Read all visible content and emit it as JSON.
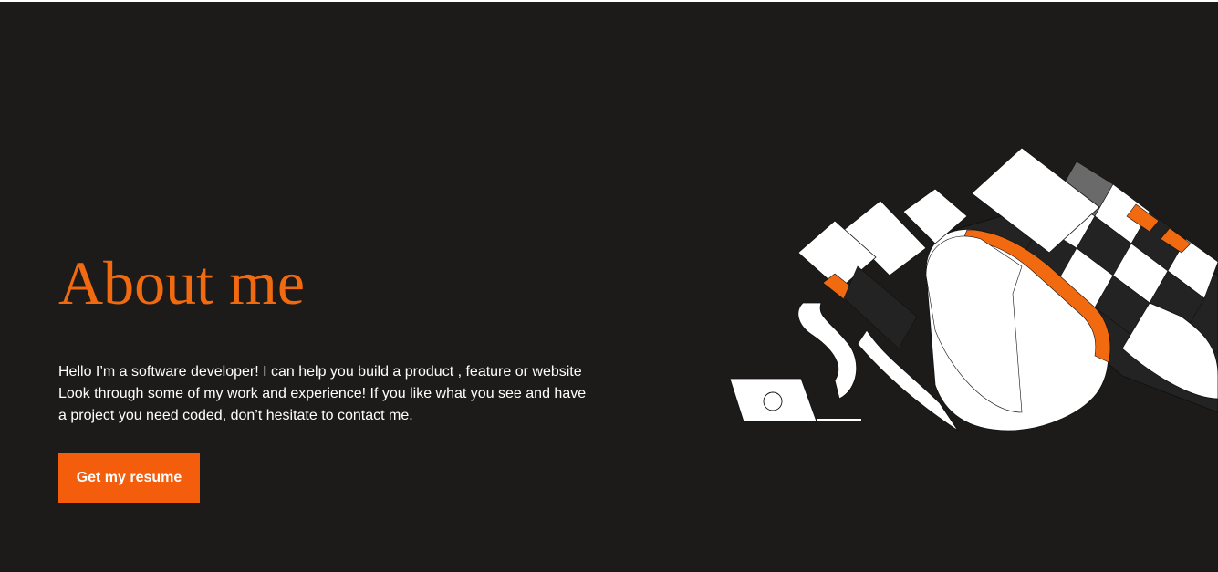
{
  "hero": {
    "title": "About me",
    "description": "Hello I’m a software developer! I can help you build a product , feature or website Look through some of my work and experience! If you like what you see and have a project you need coded, don’t hesitate to contact me.",
    "button_label": "Get my resume"
  },
  "illustration": {
    "icon": "abstract-laptop-illustration"
  },
  "colors": {
    "background": "#1c1b1a",
    "accent": "#f26a10",
    "button": "#f45d0c",
    "text": "#ffffff"
  }
}
